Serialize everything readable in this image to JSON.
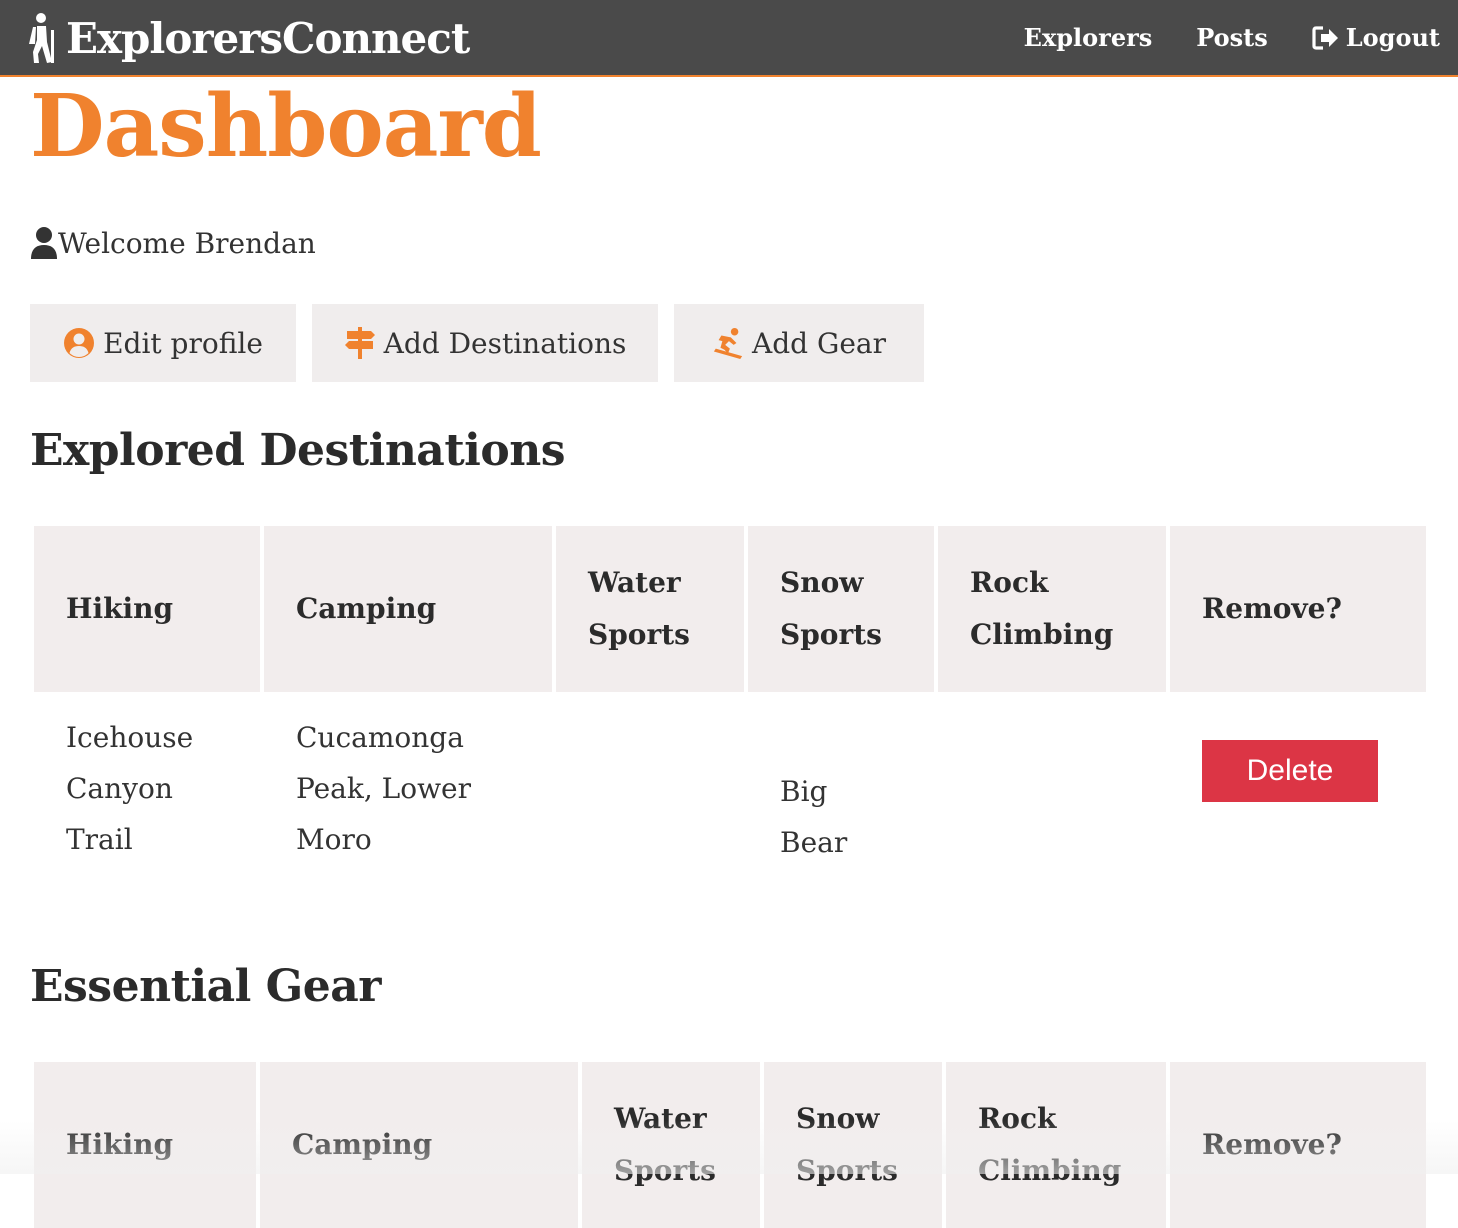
{
  "navbar": {
    "brand": "ExplorersConnect",
    "brand_icon": "hiker-icon",
    "links": [
      {
        "label": "Explorers"
      },
      {
        "label": "Posts"
      },
      {
        "label": "Logout",
        "icon": "sign-out-icon"
      }
    ]
  },
  "page": {
    "title": "Dashboard",
    "welcome": "Welcome Brendan"
  },
  "actions": [
    {
      "label": "Edit profile",
      "icon": "user-circle-icon"
    },
    {
      "label": "Add Destinations",
      "icon": "signpost-icon"
    },
    {
      "label": "Add Gear",
      "icon": "snowboarding-icon"
    }
  ],
  "destinations": {
    "title": "Explored Destinations",
    "headers": [
      "Hiking",
      "Camping",
      "Water Sports",
      "Snow Sports",
      "Rock Climbing",
      "Remove?"
    ],
    "rows": [
      {
        "hiking": "Icehouse Canyon Trail",
        "camping": "Cucamonga Peak, Lower Moro",
        "water": "",
        "snow": "Big Bear",
        "rock": "",
        "remove_label": "Delete"
      }
    ]
  },
  "gear": {
    "title": "Essential Gear",
    "headers": [
      "Hiking",
      "Camping",
      "Water Sports",
      "Snow Sports",
      "Rock Climbing",
      "Remove?"
    ]
  },
  "colors": {
    "accent": "#f0822e",
    "navbar": "#4a4a4a",
    "header_cell": "#f2eded",
    "danger": "#dc3545"
  }
}
